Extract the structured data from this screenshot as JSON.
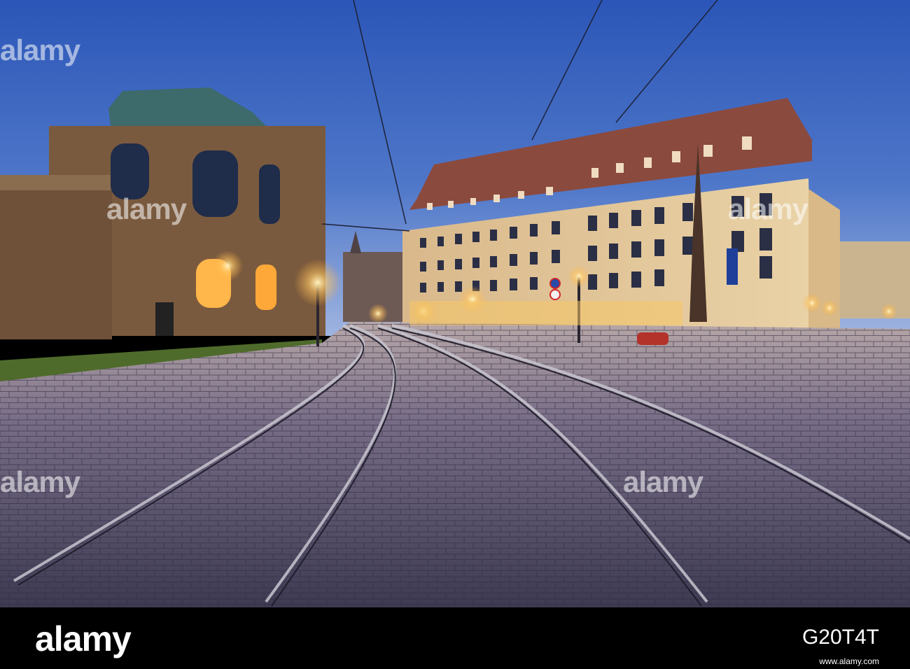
{
  "photo": {
    "subject": "",
    "colors": {
      "sky_top": "#2f58b8",
      "sky_bottom": "#7fa0d8",
      "facade": "#e8c88e",
      "pavilion": "#8a6a48",
      "street": "#5a5670",
      "lamp": "#ffd27a"
    }
  },
  "watermark": {
    "text": "alamy"
  },
  "footer": {
    "logo": "alamy",
    "image_id": "G20T4T",
    "meta": "",
    "url": "www.alamy.com"
  }
}
